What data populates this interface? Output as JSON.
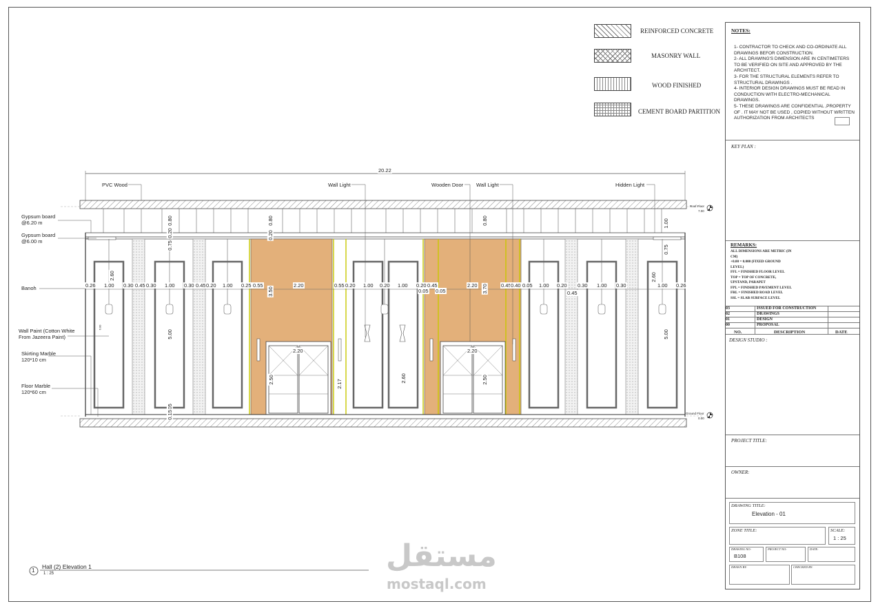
{
  "legend": [
    {
      "label": "REINFORCED CONCRETE",
      "pattern": "reinforced-concrete"
    },
    {
      "label": "MASONRY WALL",
      "pattern": "masonry-wall"
    },
    {
      "label": "WOOD FINISHED",
      "pattern": "wood-finished"
    },
    {
      "label": "CEMENT BOARD PARTITION",
      "pattern": "cement-board"
    }
  ],
  "notes": {
    "title": "NOTES:",
    "items": [
      "1- CONTRACTOR TO CHECK AND CO-ORDINATE ALL DRAWINGS BEFOR CONSTRUCTION.",
      "2- ALL DRAWING'S DIMENSION ARE IN CENTIMETERS TO BE VERIFIED ON SITE AND APPROVED BY THE ARCHITECT.",
      "3- FOR THE STRUCTURAL ELEMENTS REFER TO STRUCTURAL DRAWINGS .",
      "4- INTERIOR DESIGN DRAWINGS MUST BE READ IN CONDUCTION WITH ELECTRO-MECHANICAL DRAWINGS.",
      "5- THESE DRAWINGS ARE CONFIDENTIAL ,PROPERTY OF . IT MAY NOT BE USED , COPIED WITHOUT WRITTEN AUTHORIZATION FROM ARCHITECTS"
    ]
  },
  "key_plan": "KEY PLAN :",
  "remarks": {
    "title": "REMARKS:",
    "items": [
      "ALL DIMENSIONS ARE METRIC (IN CM)",
      "+0.00 = 0.000 (FIXED GROUND LEVEL)",
      "FFL = FINISHED FLOOR LEVEL",
      "TOP = TOP OF CONCRETE, UPSTAND, PARAPET",
      "FPL = FINISHED PAVEMENT LEVEL",
      "FRL = FINISHED ROAD LEVEL",
      "SSL = SLAB SURFACE LEVEL"
    ]
  },
  "revisions": {
    "rows": [
      {
        "no": "03",
        "desc": "ISSUED FOR CONSTRUCTION"
      },
      {
        "no": "02",
        "desc": "DRAWINGS"
      },
      {
        "no": "01",
        "desc": "DESIGN"
      },
      {
        "no": "00",
        "desc": "PROPOSAL"
      }
    ],
    "headers": [
      "NO.",
      "DESCRIPTION",
      "DATE"
    ]
  },
  "design_studio": "DESIGN STUDIO :",
  "project_title": "PROJECT TITLE:",
  "owner": "OWNER:",
  "drawing_title_label": "DRAWING TITLE:",
  "drawing_title": "Elevation - 01",
  "zone_title_label": "ZONE TITLE:",
  "scale_label": "SCALE:",
  "scale": "1 : 25",
  "drawing_no_label": "DRAWING NO:",
  "drawing_no": "B108",
  "project_no_label": "PROJECT NO:",
  "date_label": "DATE:",
  "drawn_by_label": "DRAWN BY:",
  "checked_by_label": "CHECKED BY:",
  "elevation": {
    "overall_width": "20.22",
    "callouts_top": [
      "PVC Wood",
      "Wall Light",
      "Wooden Door",
      "Wall Light",
      "Hidden Light"
    ],
    "callouts_left": [
      "Gypsum board @6.20 m",
      "Gypsum board @6.00 m",
      "Banoh",
      "Wall Paint (Cotton White From Jazeera Paint)",
      "Skirting Marble 120*10 cm",
      "Floor Marble 120*60 cm"
    ],
    "roof_level_label": "Roof Floor",
    "roof_level_value": "7.00",
    "ground_level_label": "Ground Floor",
    "ground_level_value": "0.00",
    "horizontal_dims": [
      "0.26",
      "1.00",
      "0.30",
      "0.45",
      "0.30",
      "1.00",
      "0.30",
      "0.45",
      "0.20",
      "1.00",
      "0.25",
      "0.55",
      "2.20",
      "0.55",
      "0.20",
      "1.00",
      "0.20",
      "1.00",
      "0.20",
      "0.45",
      "2.20",
      "0.45",
      "0.40",
      "0.05",
      "1.00",
      "0.20",
      "0.30",
      "1.00",
      "0.30",
      "1.00",
      "0.26"
    ],
    "extra_dims": [
      "0.05",
      "0.05",
      "0.45",
      "2.20",
      "2.20"
    ],
    "vertical_dims": [
      "0.80",
      "0.20",
      "0.75",
      "2.60",
      "5.00",
      "0.05",
      "0.15",
      "3.50",
      "2.50",
      "2.17",
      "2.60",
      "3.70",
      "2.50",
      "0.80",
      "1.00",
      "0.75",
      "2.60",
      "5.00"
    ],
    "small_mark": "6.00"
  },
  "view_title": {
    "number": "1",
    "name": "Hall (2) Elevation 1",
    "scale": "1 : 25"
  },
  "watermark": {
    "arabic": "مستقل",
    "latin": "mostaql.com"
  }
}
